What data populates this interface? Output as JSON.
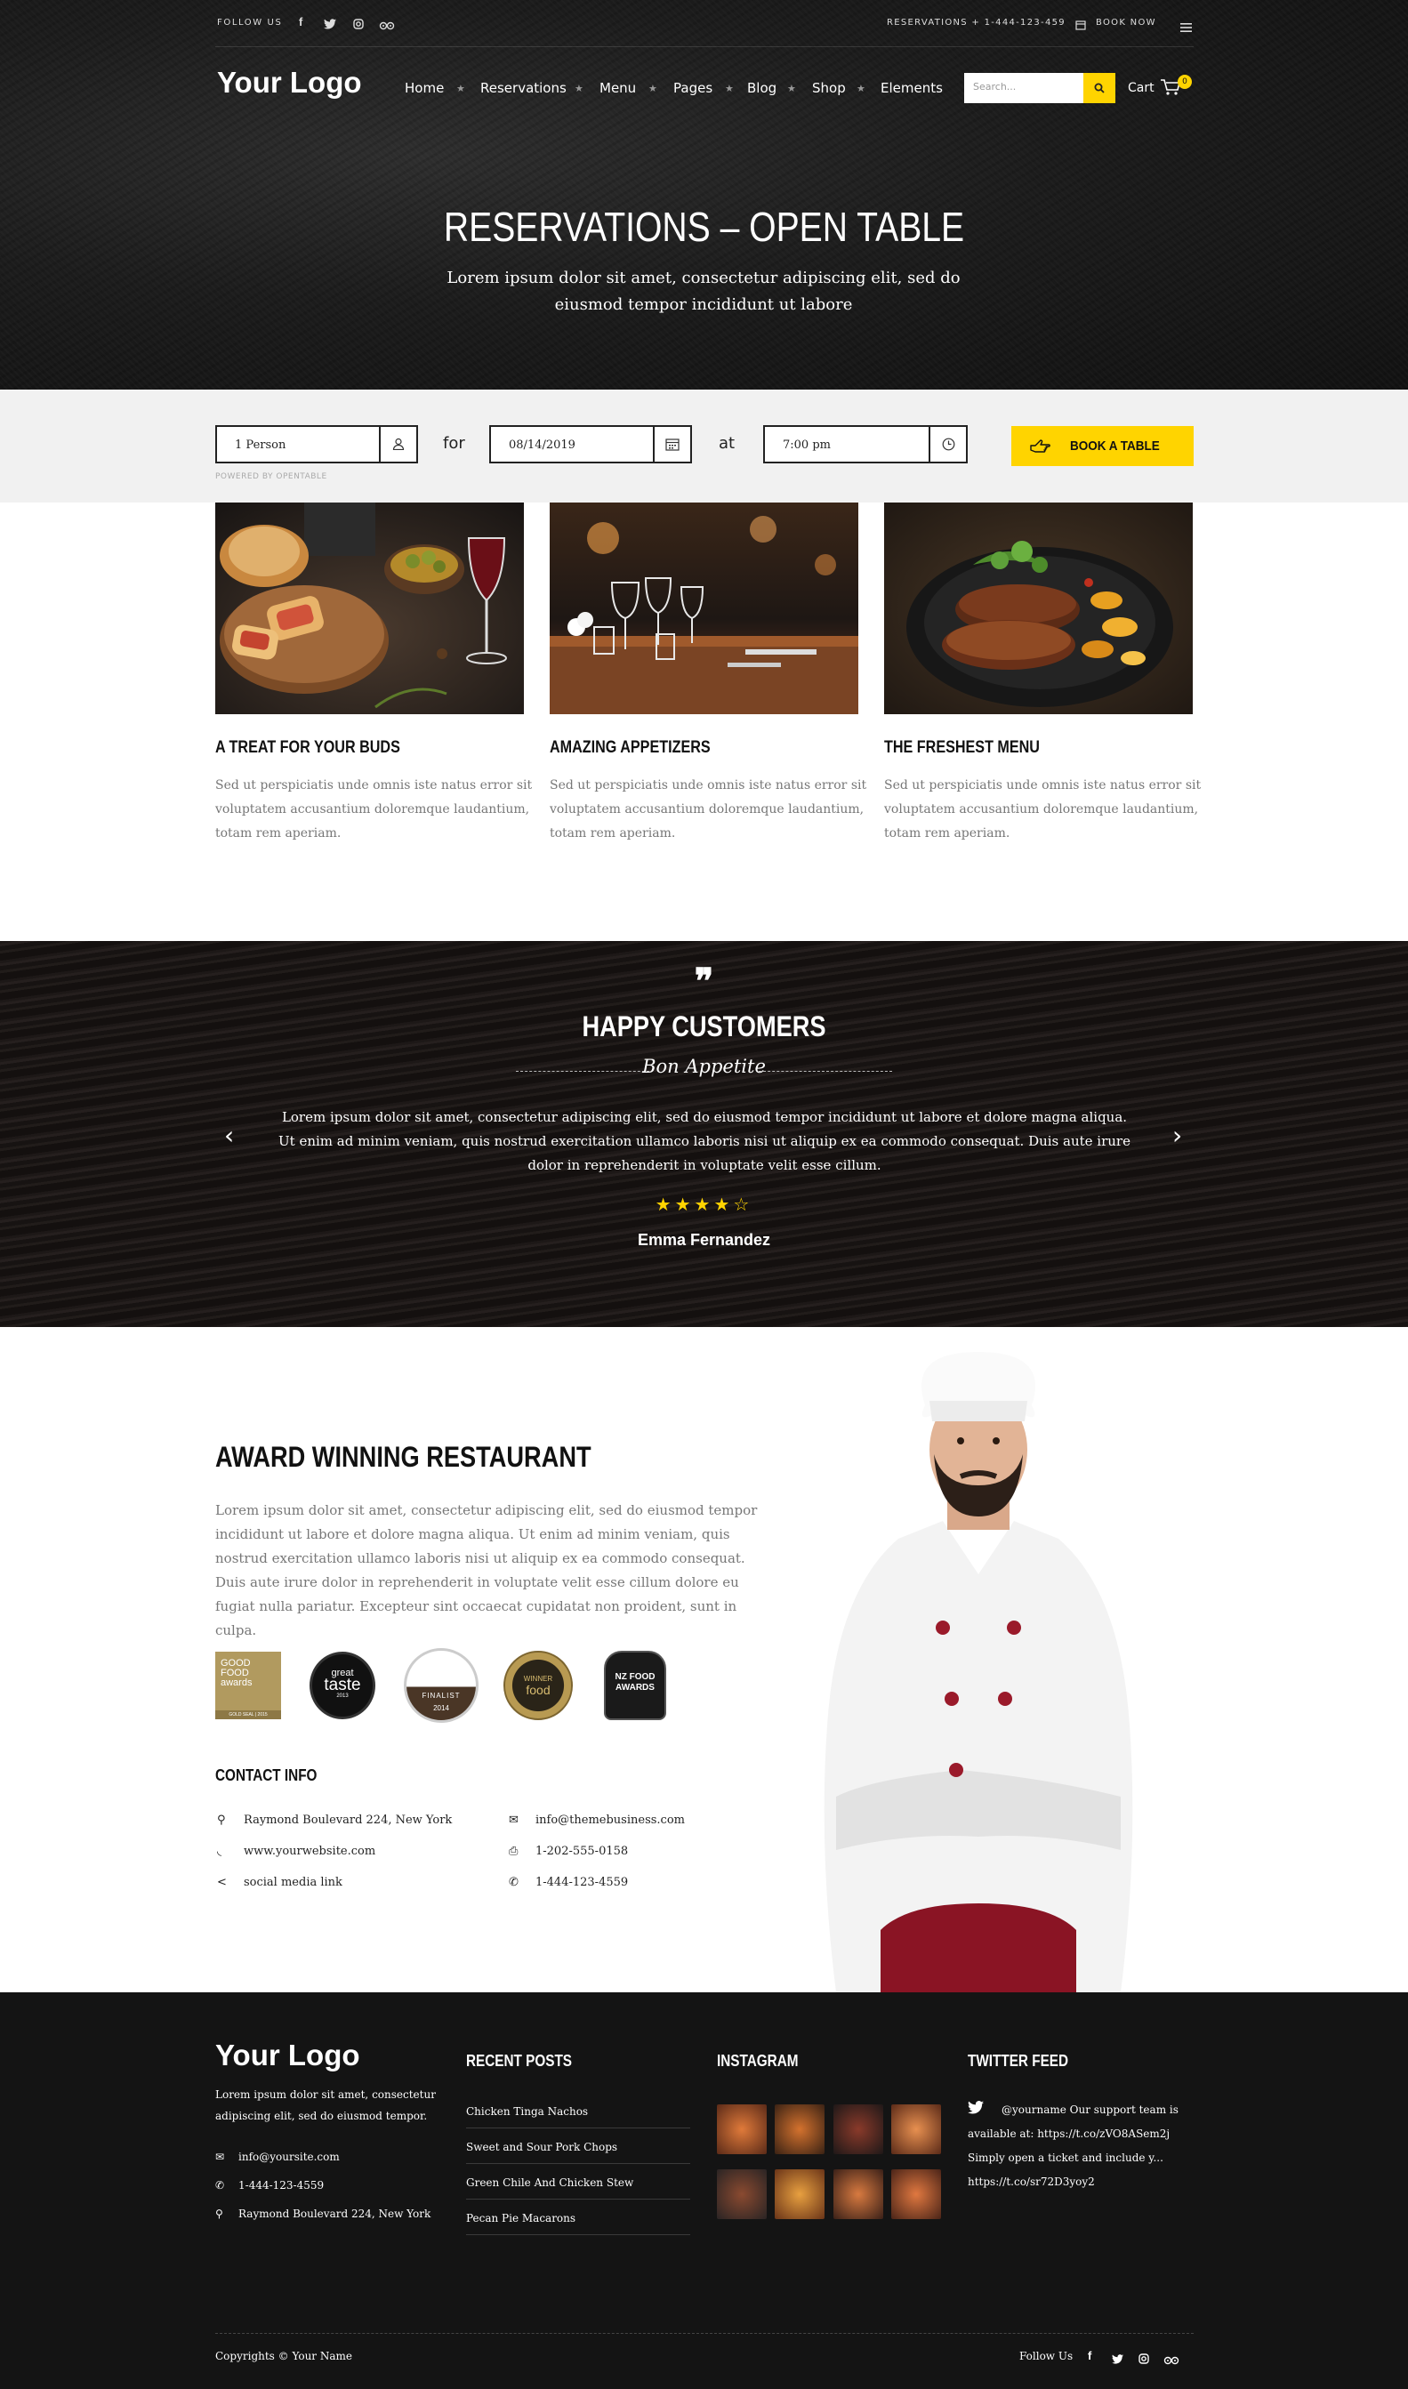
{
  "topbar": {
    "follow_label": "FOLLOW US",
    "reservations": "RESERVATIONS + 1-444-123-459",
    "book_now": "BOOK NOW",
    "social_icons": [
      "facebook-icon",
      "twitter-icon",
      "instagram-icon",
      "tripadvisor-icon"
    ]
  },
  "header": {
    "logo": "Your Logo",
    "nav": [
      "Home",
      "Reservations",
      "Menu",
      "Pages",
      "Blog",
      "Shop",
      "Elements"
    ],
    "search_placeholder": "Search...",
    "cart_label": "Cart",
    "cart_count": "0"
  },
  "hero": {
    "title": "RESERVATIONS – OPEN TABLE",
    "subtitle": "Lorem ipsum dolor sit amet, consectetur adipiscing elit, sed do eiusmod tempor incididunt ut labore"
  },
  "reservation": {
    "party": "1 Person",
    "for_label": "for",
    "date": "08/14/2019",
    "at_label": "at",
    "time": "7:00 pm",
    "book_button": "BOOK A TABLE",
    "powered": "POWERED BY OPENTABLE"
  },
  "features": [
    {
      "title": "A TREAT FOR YOUR BUDS",
      "text": "Sed ut perspiciatis unde omnis iste natus error sit voluptatem accusantium doloremque laudantium, totam rem aperiam."
    },
    {
      "title": "AMAZING APPETIZERS",
      "text": "Sed ut perspiciatis unde omnis iste natus error sit voluptatem accusantium doloremque laudantium, totam rem aperiam."
    },
    {
      "title": "THE FRESHEST MENU",
      "text": "Sed ut perspiciatis unde omnis iste natus error sit voluptatem accusantium doloremque laudantium, totam rem aperiam."
    }
  ],
  "testimonials": {
    "quote_mark": "❞",
    "title": "HAPPY CUSTOMERS",
    "script": "Bon Appetite",
    "text": "Lorem ipsum dolor sit amet, consectetur adipiscing elit, sed do eiusmod tempor incididunt ut labore et dolore magna aliqua. Ut enim ad minim veniam, quis nostrud exercitation ullamco laboris nisi ut aliquip ex ea commodo consequat. Duis aute irure dolor in reprehenderit in voluptate velit esse cillum.",
    "rating": 4,
    "rating_max": 5,
    "stars": "★★★★☆",
    "author": "Emma Fernandez"
  },
  "award": {
    "title": "AWARD WINNING RESTAURANT",
    "text": "Lorem ipsum dolor sit amet, consectetur adipiscing elit, sed do eiusmod tempor incididunt ut labore et dolore magna aliqua. Ut enim ad minim veniam, quis nostrud exercitation ullamco laboris nisi ut aliquip ex ea commodo consequat. Duis aute irure dolor in reprehenderit in voluptate velit esse cillum dolore eu fugiat nulla pariatur. Excepteur sint occaecat cupidatat non proident, sunt in culpa.",
    "badges": [
      {
        "lines": [
          "GOOD",
          "FOOD",
          "awards"
        ],
        "foot": "GOLD SEAL | 2015"
      },
      {
        "lines": [
          "great",
          "taste"
        ],
        "foot": "2013"
      },
      {
        "lines": [
          "FINALIST"
        ],
        "foot": "2014"
      },
      {
        "lines": [
          "WINNER",
          "food"
        ],
        "foot": ""
      },
      {
        "lines": [
          "NZ FOOD",
          "AWARDS"
        ],
        "foot": ""
      }
    ]
  },
  "contact": {
    "title": "CONTACT INFO",
    "address": "Raymond Boulevard 224, New York",
    "website": "www.yourwebsite.com",
    "social": "social media link",
    "email": "info@themebusiness.com",
    "fax": "1-202-555-0158",
    "phone": "1-444-123-4559"
  },
  "footer": {
    "logo": "Your Logo",
    "about": "Lorem ipsum dolor sit amet, consectetur adipiscing elit, sed do eiusmod tempor.",
    "email": "info@yoursite.com",
    "phone": "1-444-123-4559",
    "address": "Raymond Boulevard 224, New York",
    "recent_posts_title": "RECENT POSTS",
    "posts": [
      "Chicken Tinga Nachos",
      "Sweet and Sour Pork Chops",
      "Green Chile And Chicken Stew",
      "Pecan Pie Macarons"
    ],
    "instagram_title": "INSTAGRAM",
    "twitter_title": "TWITTER FEED",
    "tweet": "@yourname  Our support team is available at: https://t.co/zVO8ASem2j Simply open a ticket and include y... https://t.co/sr72D3yoy2",
    "copyright": "Copyrights © Your Name",
    "follow_label": "Follow Us"
  },
  "colors": {
    "accent": "#ffd400",
    "dark": "#141414",
    "light_gray": "#f1f1f1"
  }
}
